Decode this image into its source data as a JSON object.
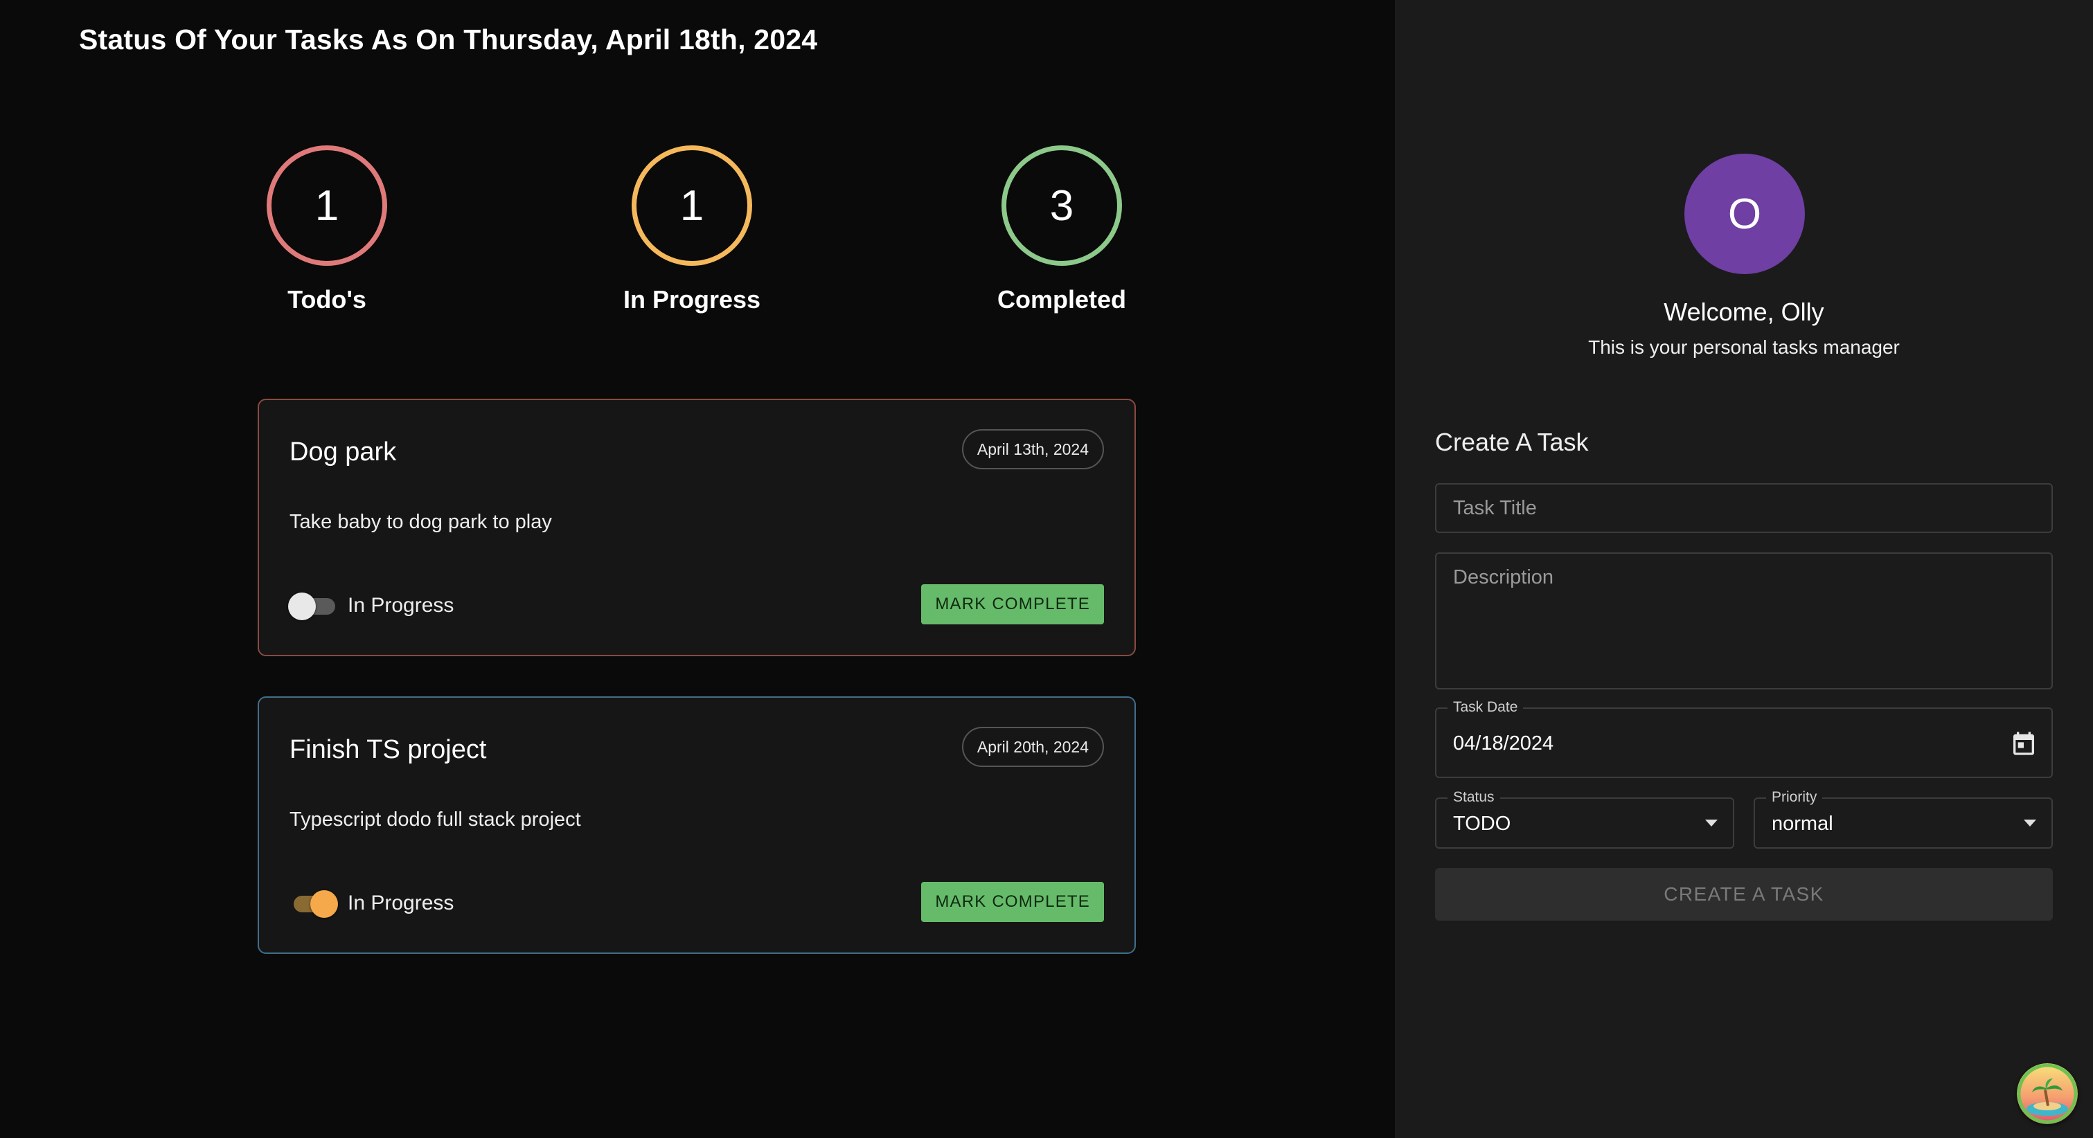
{
  "page": {
    "title": "Status Of Your Tasks As On Thursday, April 18th, 2024"
  },
  "stats": [
    {
      "value": "1",
      "label": "Todo's",
      "color": "#e07a7a"
    },
    {
      "value": "1",
      "label": "In Progress",
      "color": "#f5b85b"
    },
    {
      "value": "3",
      "label": "Completed",
      "color": "#8cc98a"
    }
  ],
  "tasks": [
    {
      "title": "Dog park",
      "date": "April 13th, 2024",
      "description": "Take baby to dog park to play",
      "toggle_label": "In Progress",
      "toggle_on": false,
      "button_label": "MARK COMPLETE",
      "border_color": "#8a4a3f"
    },
    {
      "title": "Finish TS project",
      "date": "April 20th, 2024",
      "description": "Typescript dodo full stack project",
      "toggle_label": "In Progress",
      "toggle_on": true,
      "button_label": "MARK COMPLETE",
      "border_color": "#3f6f8a"
    }
  ],
  "sidebar": {
    "avatar_initial": "O",
    "avatar_color": "#6f3fa3",
    "welcome": "Welcome, Olly",
    "subtitle": "This is your personal tasks manager",
    "form": {
      "title": "Create A Task",
      "task_title_placeholder": "Task Title",
      "description_placeholder": "Description",
      "date_label": "Task Date",
      "date_value": "04/18/2024",
      "status_label": "Status",
      "status_value": "TODO",
      "priority_label": "Priority",
      "priority_value": "normal",
      "submit_label": "CREATE A TASK"
    }
  },
  "icons": {
    "calendar": "calendar-icon",
    "dropdown": "chevron-down-icon",
    "corner": "beach-island-icon"
  }
}
